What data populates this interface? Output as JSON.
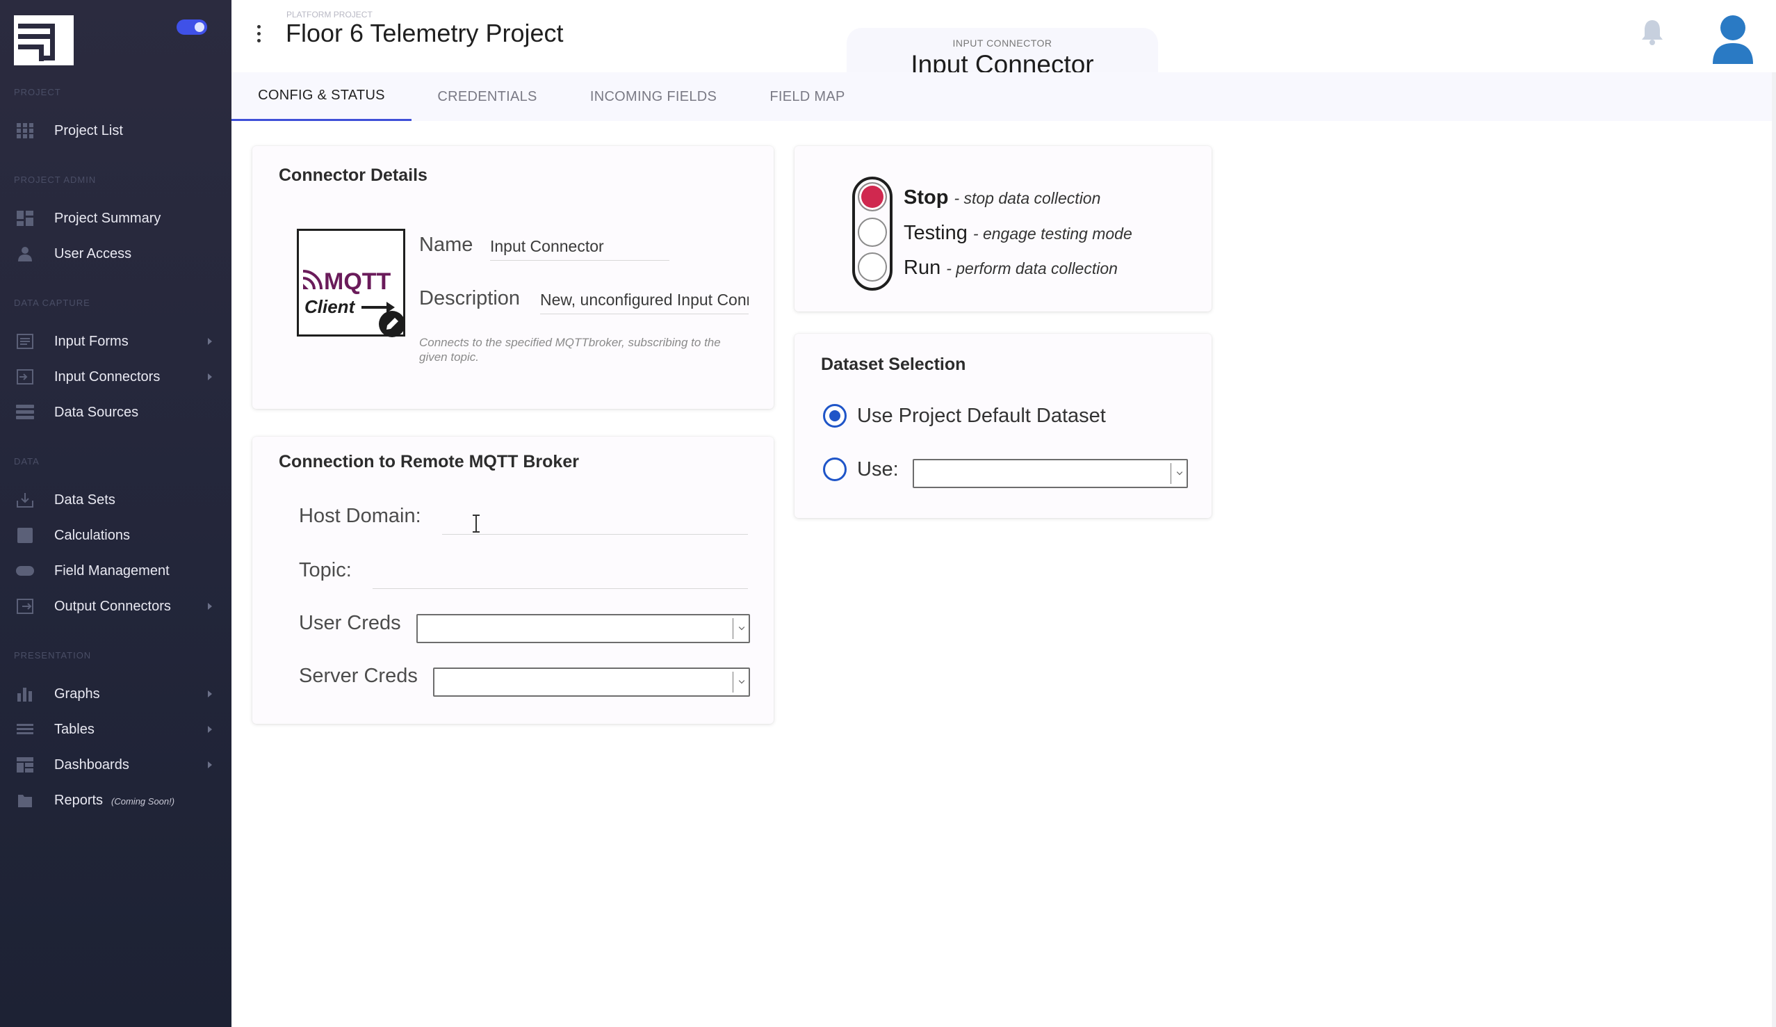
{
  "sidebar": {
    "sections": [
      "Project",
      "Project Admin",
      "Data Capture",
      "Data",
      "Presentation"
    ],
    "items": [
      {
        "label": "Project List",
        "icon": "grid-icon",
        "arrow": false
      },
      {
        "label": "Project Summary",
        "icon": "dashboard-icon",
        "arrow": false
      },
      {
        "label": "User Access",
        "icon": "user-icon",
        "arrow": false
      },
      {
        "label": "Input Forms",
        "icon": "form-icon",
        "arrow": true
      },
      {
        "label": "Input Connectors",
        "icon": "input-connector-icon",
        "arrow": true
      },
      {
        "label": "Data Sources",
        "icon": "data-sources-icon",
        "arrow": false
      },
      {
        "label": "Data Sets",
        "icon": "download-tray-icon",
        "arrow": false
      },
      {
        "label": "Calculations",
        "icon": "calculator-icon",
        "arrow": false
      },
      {
        "label": "Field Management",
        "icon": "field-icon",
        "arrow": false
      },
      {
        "label": "Output Connectors",
        "icon": "output-connector-icon",
        "arrow": true
      },
      {
        "label": "Graphs",
        "icon": "bar-chart-icon",
        "arrow": true
      },
      {
        "label": "Tables",
        "icon": "table-lines-icon",
        "arrow": true
      },
      {
        "label": "Dashboards",
        "icon": "dashboard-grid-icon",
        "arrow": true
      },
      {
        "label": "Reports",
        "icon": "report-icon",
        "arrow": false,
        "note": "(Coming Soon!)"
      }
    ]
  },
  "header": {
    "kicker": "PLATFORM PROJECT",
    "project_title": "Floor 6 Telemetry Project",
    "center_kicker": "INPUT CONNECTOR",
    "center_title": "Input Connector"
  },
  "tabs": [
    {
      "label": "CONFIG & STATUS",
      "active": true
    },
    {
      "label": "CREDENTIALS",
      "active": false
    },
    {
      "label": "INCOMING FIELDS",
      "active": false
    },
    {
      "label": "FIELD MAP",
      "active": false
    }
  ],
  "connector_details": {
    "title": "Connector Details",
    "logo_text_top": "MQTT",
    "logo_text_bottom": "Client",
    "name_label": "Name",
    "name_value": "Input Connector",
    "description_label": "Description",
    "description_value": "New, unconfigured Input Connector",
    "help_text": "Connects to the specified MQTTbroker, subscribing to the given topic."
  },
  "broker": {
    "title": "Connection to Remote MQTT Broker",
    "host_label": "Host Domain:",
    "host_value": "",
    "topic_label": "Topic:",
    "topic_value": "",
    "user_creds_label": "User Creds",
    "user_creds_value": "",
    "server_creds_label": "Server Creds",
    "server_creds_value": ""
  },
  "status": {
    "selected": "Stop",
    "options": [
      {
        "name": "Stop",
        "desc": "- stop data collection"
      },
      {
        "name": "Testing",
        "desc": "- engage testing mode"
      },
      {
        "name": "Run",
        "desc": "- perform data collection"
      }
    ],
    "stop_color": "#d0284f"
  },
  "dataset": {
    "title": "Dataset Selection",
    "default_label": "Use Project Default Dataset",
    "use_label": "Use:",
    "selected": "default",
    "use_value": ""
  },
  "colors": {
    "sidebar_bg": "#262a3d",
    "accent": "#3f4fd8",
    "radio": "#1f55c8",
    "avatar": "#2a7ac4"
  }
}
